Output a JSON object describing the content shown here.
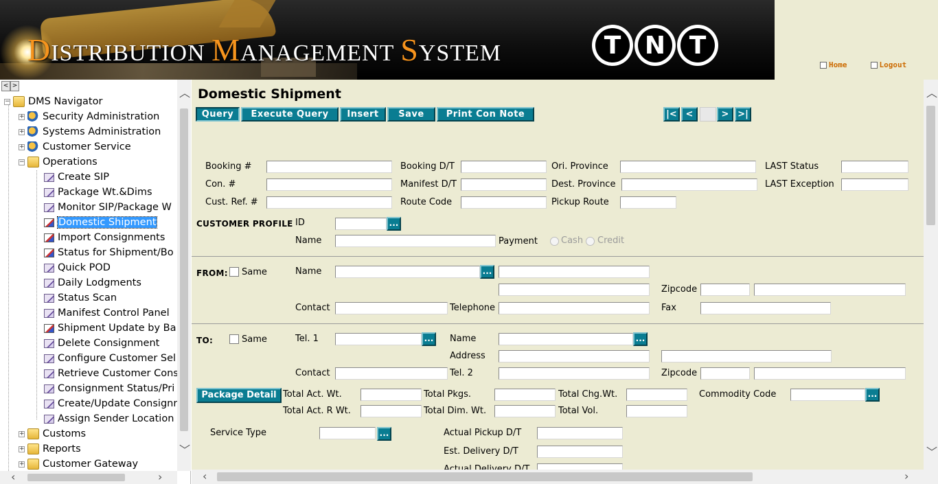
{
  "banner": {
    "title_parts": [
      {
        "cap": "D",
        "rest": "ISTRIBUTION "
      },
      {
        "cap": "M",
        "rest": "ANAGEMENT "
      },
      {
        "cap": "S",
        "rest": "YSTEM"
      }
    ],
    "logo_letters": [
      "T",
      "N",
      "T"
    ],
    "home_label": "Home",
    "logout_label": "Logout"
  },
  "nav": {
    "scroll_left": "<",
    "scroll_right": ">",
    "root": "DMS Navigator",
    "groups": [
      {
        "label": "Security Administration",
        "icon": "users-icon"
      },
      {
        "label": "Systems Administration",
        "icon": "gears-icon"
      },
      {
        "label": "Customer Service",
        "icon": "phone-icon"
      },
      {
        "label": "Operations",
        "icon": "box-icon"
      }
    ],
    "operations_items": [
      "Create SIP",
      "Package Wt.&Dims",
      "Monitor SIP/Package W",
      "Domestic Shipment",
      "Import Consignments",
      "Status for Shipment/Bo",
      "Quick POD",
      "Daily Lodgments",
      "Status Scan",
      "Manifest Control Panel",
      "Shipment Update by Ba",
      "Delete Consignment",
      "Configure Customer Sel",
      "Retrieve Customer Cons",
      "Consignment Status/Pri",
      "Create/Update Consignr",
      "Assign Sender Location"
    ],
    "selected_index": 3,
    "bottom_groups": [
      {
        "label": "Customs",
        "icon": "box-icon"
      },
      {
        "label": "Reports",
        "icon": "report-icon"
      },
      {
        "label": "Customer Gateway",
        "icon": "gateway-icon"
      }
    ]
  },
  "main": {
    "title": "Domestic Shipment",
    "toolbar": {
      "query": "Query",
      "execute_query": "Execute Query",
      "insert": "Insert",
      "save": "Save",
      "print_con_note": "Print Con Note"
    },
    "pager": {
      "first": "|<",
      "prev": "<",
      "next": ">",
      "last": ">|"
    },
    "fields": {
      "booking_no": "Booking #",
      "booking_dt": "Booking D/T",
      "ori_province": "Ori. Province",
      "last_status": "LAST Status",
      "con_no": "Con. #",
      "manifest_dt": "Manifest D/T",
      "dest_province": "Dest. Province",
      "last_exception": "LAST Exception",
      "cust_ref": "Cust. Ref. #",
      "route_code": "Route Code",
      "pickup_route": "Pickup Route"
    },
    "customer_profile": {
      "header": "CUSTOMER PROFILE",
      "id": "ID",
      "name": "Name",
      "payment": "Payment",
      "cash": "Cash",
      "credit": "Credit"
    },
    "from": {
      "header": "FROM:",
      "same": "Same",
      "name": "Name",
      "zipcode": "Zipcode",
      "contact": "Contact",
      "telephone": "Telephone",
      "fax": "Fax"
    },
    "to": {
      "header": "TO:",
      "same": "Same",
      "tel1": "Tel. 1",
      "name": "Name",
      "address": "Address",
      "contact": "Contact",
      "tel2": "Tel. 2",
      "zipcode": "Zipcode"
    },
    "package": {
      "button": "Package Detail",
      "total_act_wt": "Total Act. Wt.",
      "total_pkgs": "Total Pkgs.",
      "total_chg_wt": "Total Chg.Wt.",
      "commodity_code": "Commodity Code",
      "total_act_r_wt": "Total Act. R Wt.",
      "total_dim_wt": "Total Dim. Wt.",
      "total_vol": "Total Vol."
    },
    "service": {
      "service_type": "Service Type",
      "actual_pickup": "Actual Pickup D/T",
      "est_delivery": "Est. Delivery D/T",
      "actual_delivery": "Actual Delivery D/T"
    },
    "lookup_label": "..."
  },
  "colors": {
    "accent_teal": "#0a7d92",
    "form_bg": "#ecebd3",
    "brand_orange": "#f7941d",
    "selected": "#3399ff"
  }
}
